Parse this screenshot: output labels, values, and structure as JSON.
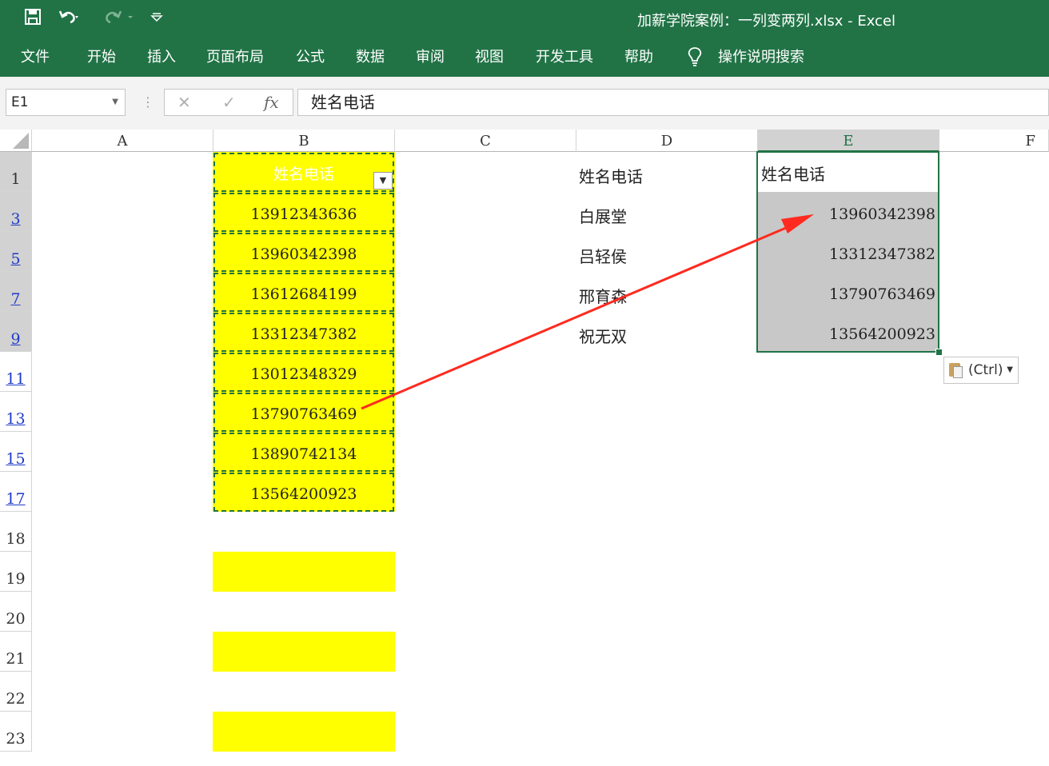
{
  "window": {
    "title": "加薪学院案例：一列变两列.xlsx  -  Excel"
  },
  "quick_access": {
    "icons": [
      "save-icon",
      "undo-icon",
      "redo-icon",
      "customize-icon"
    ]
  },
  "menu": {
    "items": [
      "文件",
      "开始",
      "插入",
      "页面布局",
      "公式",
      "数据",
      "审阅",
      "视图",
      "开发工具",
      "帮助"
    ],
    "tell_me": "操作说明搜索"
  },
  "formula_bar": {
    "name_box": "E1",
    "cancel": "✕",
    "enter": "✓",
    "fx": "fx",
    "content": "姓名电话"
  },
  "columns": [
    "A",
    "B",
    "C",
    "D",
    "E",
    "F"
  ],
  "rows": [
    "1",
    "3",
    "5",
    "7",
    "9",
    "11",
    "13",
    "15",
    "17",
    "18",
    "19",
    "20",
    "21",
    "22",
    "23"
  ],
  "column_b": [
    "姓名电话",
    "13912343636",
    "13960342398",
    "13612684199",
    "13312347382",
    "13012348329",
    "13790763469",
    "13890742134",
    "13564200923"
  ],
  "column_d": [
    "姓名电话",
    "白展堂",
    "吕轻侯",
    "邢育森",
    "祝无双"
  ],
  "column_e": [
    "姓名电话",
    "13960342398",
    "13312347382",
    "13790763469",
    "13564200923"
  ],
  "paste_options": {
    "label": "(Ctrl)"
  },
  "colors": {
    "brand": "#217346",
    "highlight": "#ffff00",
    "arrow": "#ff2a1f",
    "pasted": "#c8c8c8"
  }
}
